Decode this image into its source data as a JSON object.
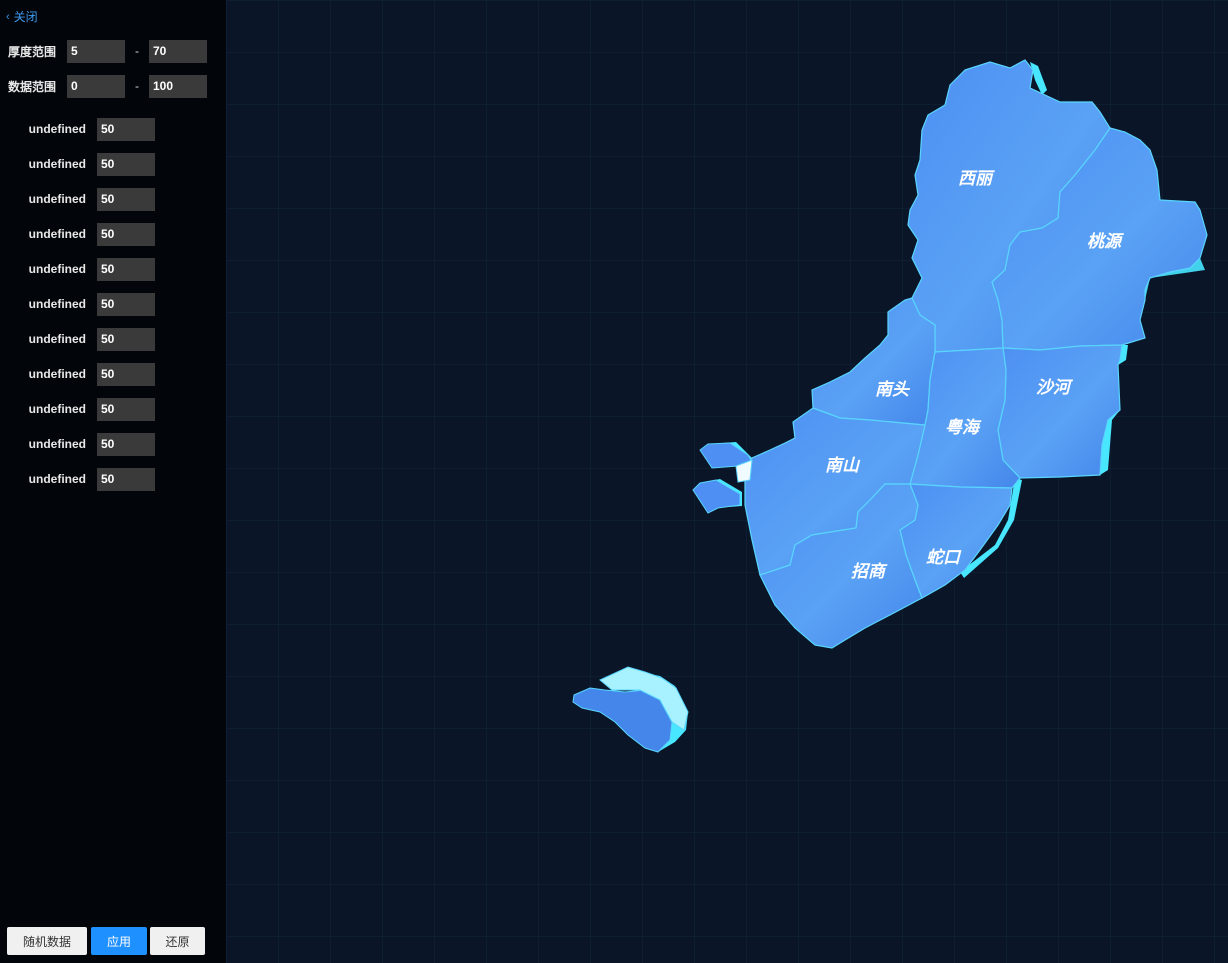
{
  "panel": {
    "close_label": "关闭",
    "thickness": {
      "label": "厚度范围",
      "min": "5",
      "max": "70",
      "separator": "-"
    },
    "data_range": {
      "label": "数据范围",
      "min": "0",
      "max": "100",
      "separator": "-"
    },
    "items": [
      {
        "label": "undefined",
        "value": "50"
      },
      {
        "label": "undefined",
        "value": "50"
      },
      {
        "label": "undefined",
        "value": "50"
      },
      {
        "label": "undefined",
        "value": "50"
      },
      {
        "label": "undefined",
        "value": "50"
      },
      {
        "label": "undefined",
        "value": "50"
      },
      {
        "label": "undefined",
        "value": "50"
      },
      {
        "label": "undefined",
        "value": "50"
      },
      {
        "label": "undefined",
        "value": "50"
      },
      {
        "label": "undefined",
        "value": "50"
      },
      {
        "label": "undefined",
        "value": "50"
      }
    ],
    "buttons": {
      "random": "随机数据",
      "apply": "应用",
      "reset": "还原"
    }
  },
  "map": {
    "regions": {
      "xili": "西丽",
      "taoyuan": "桃源",
      "nantou": "南头",
      "shahe": "沙河",
      "yuehai": "粤海",
      "nanshan": "南山",
      "shekou": "蛇口",
      "zhaoshang": "招商"
    },
    "colors": {
      "fill": "#4a8ff0",
      "edge": "#5ad8ff",
      "side": "#48e6ff",
      "background": "#0a1628",
      "grid": "#13263d"
    }
  }
}
